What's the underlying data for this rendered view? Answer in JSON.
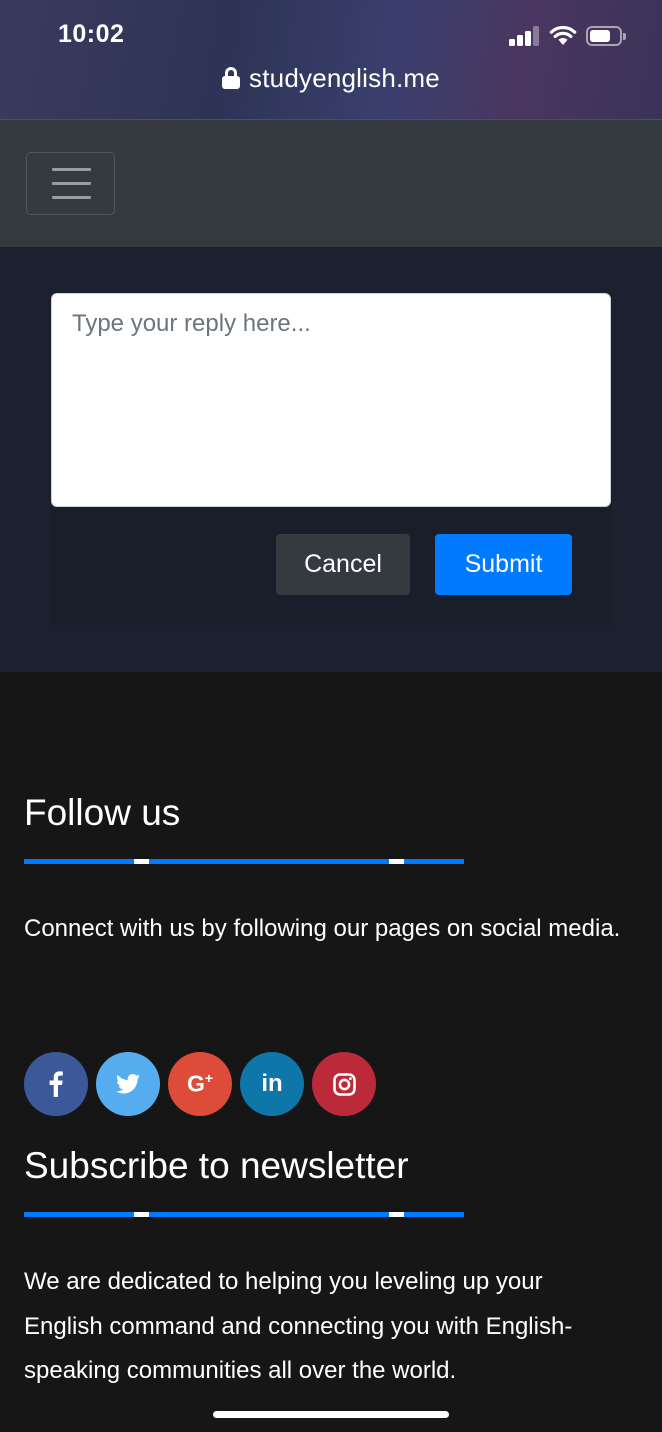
{
  "status_bar": {
    "time": "10:02",
    "signal_bars_active": 3,
    "battery_level": 0.6
  },
  "browser": {
    "url": "studyenglish.me",
    "lock_icon": "lock-icon"
  },
  "navbar": {
    "toggler_icon": "hamburger-menu-icon"
  },
  "reply": {
    "placeholder": "Type your reply here...",
    "value": "",
    "cancel_label": "Cancel",
    "submit_label": "Submit"
  },
  "footer": {
    "follow_heading": "Follow us",
    "follow_text": "Connect with us by following our pages on social media.",
    "social": [
      {
        "name": "facebook",
        "glyph": "f",
        "color": "#3b5998"
      },
      {
        "name": "twitter",
        "glyph": "twitter-bird",
        "color": "#55acee"
      },
      {
        "name": "google-plus",
        "glyph": "G+",
        "color": "#dd4b39"
      },
      {
        "name": "linkedin",
        "glyph": "in",
        "color": "#0e76a8"
      },
      {
        "name": "instagram",
        "glyph": "instagram-camera",
        "color": "#bc2a3a"
      }
    ],
    "newsletter_heading": "Subscribe to newsletter",
    "newsletter_text": "We are dedicated to helping you leveling up your English command and connecting you with English-speaking communities all over the world."
  },
  "colors": {
    "primary": "#007bff",
    "navbar": "#343a40",
    "section_bg": "#1c2130",
    "footer_bg": "#161617"
  }
}
